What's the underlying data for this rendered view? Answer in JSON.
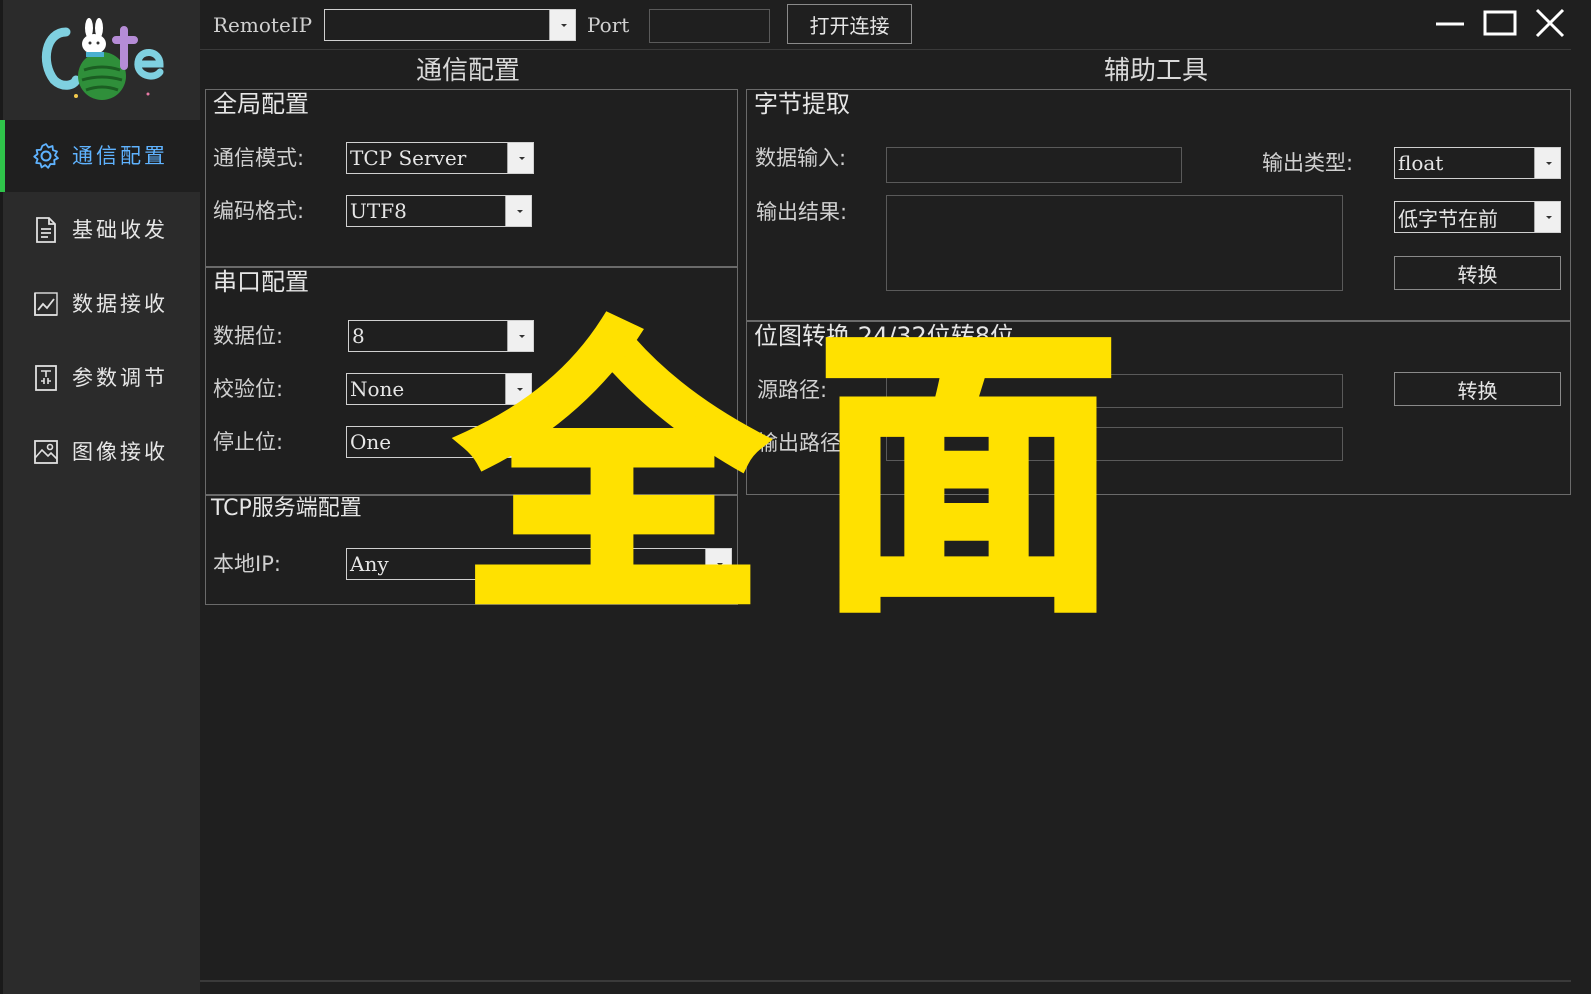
{
  "sidebar": {
    "logo_text": "Cute",
    "items": [
      {
        "label": "通信配置",
        "icon": "gear-icon",
        "active": true
      },
      {
        "label": "基础收发",
        "icon": "document-icon",
        "active": false
      },
      {
        "label": "数据接收",
        "icon": "chart-icon",
        "active": false
      },
      {
        "label": "参数调节",
        "icon": "settings-doc-icon",
        "active": false
      },
      {
        "label": "图像接收",
        "icon": "image-icon",
        "active": false
      }
    ]
  },
  "topbar": {
    "remote_ip_label": "RemoteIP",
    "remote_ip_value": "",
    "port_label": "Port",
    "port_value": "",
    "open_button": "打开连接"
  },
  "comm": {
    "section_title": "通信配置",
    "global": {
      "title": "全局配置",
      "mode_label": "通信模式:",
      "mode_value": "TCP Server",
      "encoding_label": "编码格式:",
      "encoding_value": "UTF8"
    },
    "serial": {
      "title": "串口配置",
      "databits_label": "数据位:",
      "databits_value": "8",
      "parity_label": "校验位:",
      "parity_value": "None",
      "stopbits_label": "停止位:",
      "stopbits_value": "One"
    },
    "tcp": {
      "title": "TCP服务端配置",
      "local_ip_label": "本地IP:",
      "local_ip_value": "Any"
    }
  },
  "tools": {
    "section_title": "辅助工具",
    "byte": {
      "title": "字节提取",
      "input_label": "数据输入:",
      "output_label": "输出结果:",
      "type_label": "输出类型:",
      "type_value": "float",
      "order_value": "低字节在前",
      "convert_button": "转换"
    },
    "bitmap": {
      "title": "位图转换 24/32位转8位",
      "src_label": "源路径:",
      "out_label": "输出路径:",
      "convert_button": "转换"
    }
  },
  "overlay": {
    "char1": "全",
    "char2": "面",
    "color": "#ffe100"
  },
  "colors": {
    "accent_green": "#2fc44a",
    "active_blue": "#5fb3ff",
    "background": "#1f1f1f",
    "sidebar": "#2b2b2b"
  }
}
